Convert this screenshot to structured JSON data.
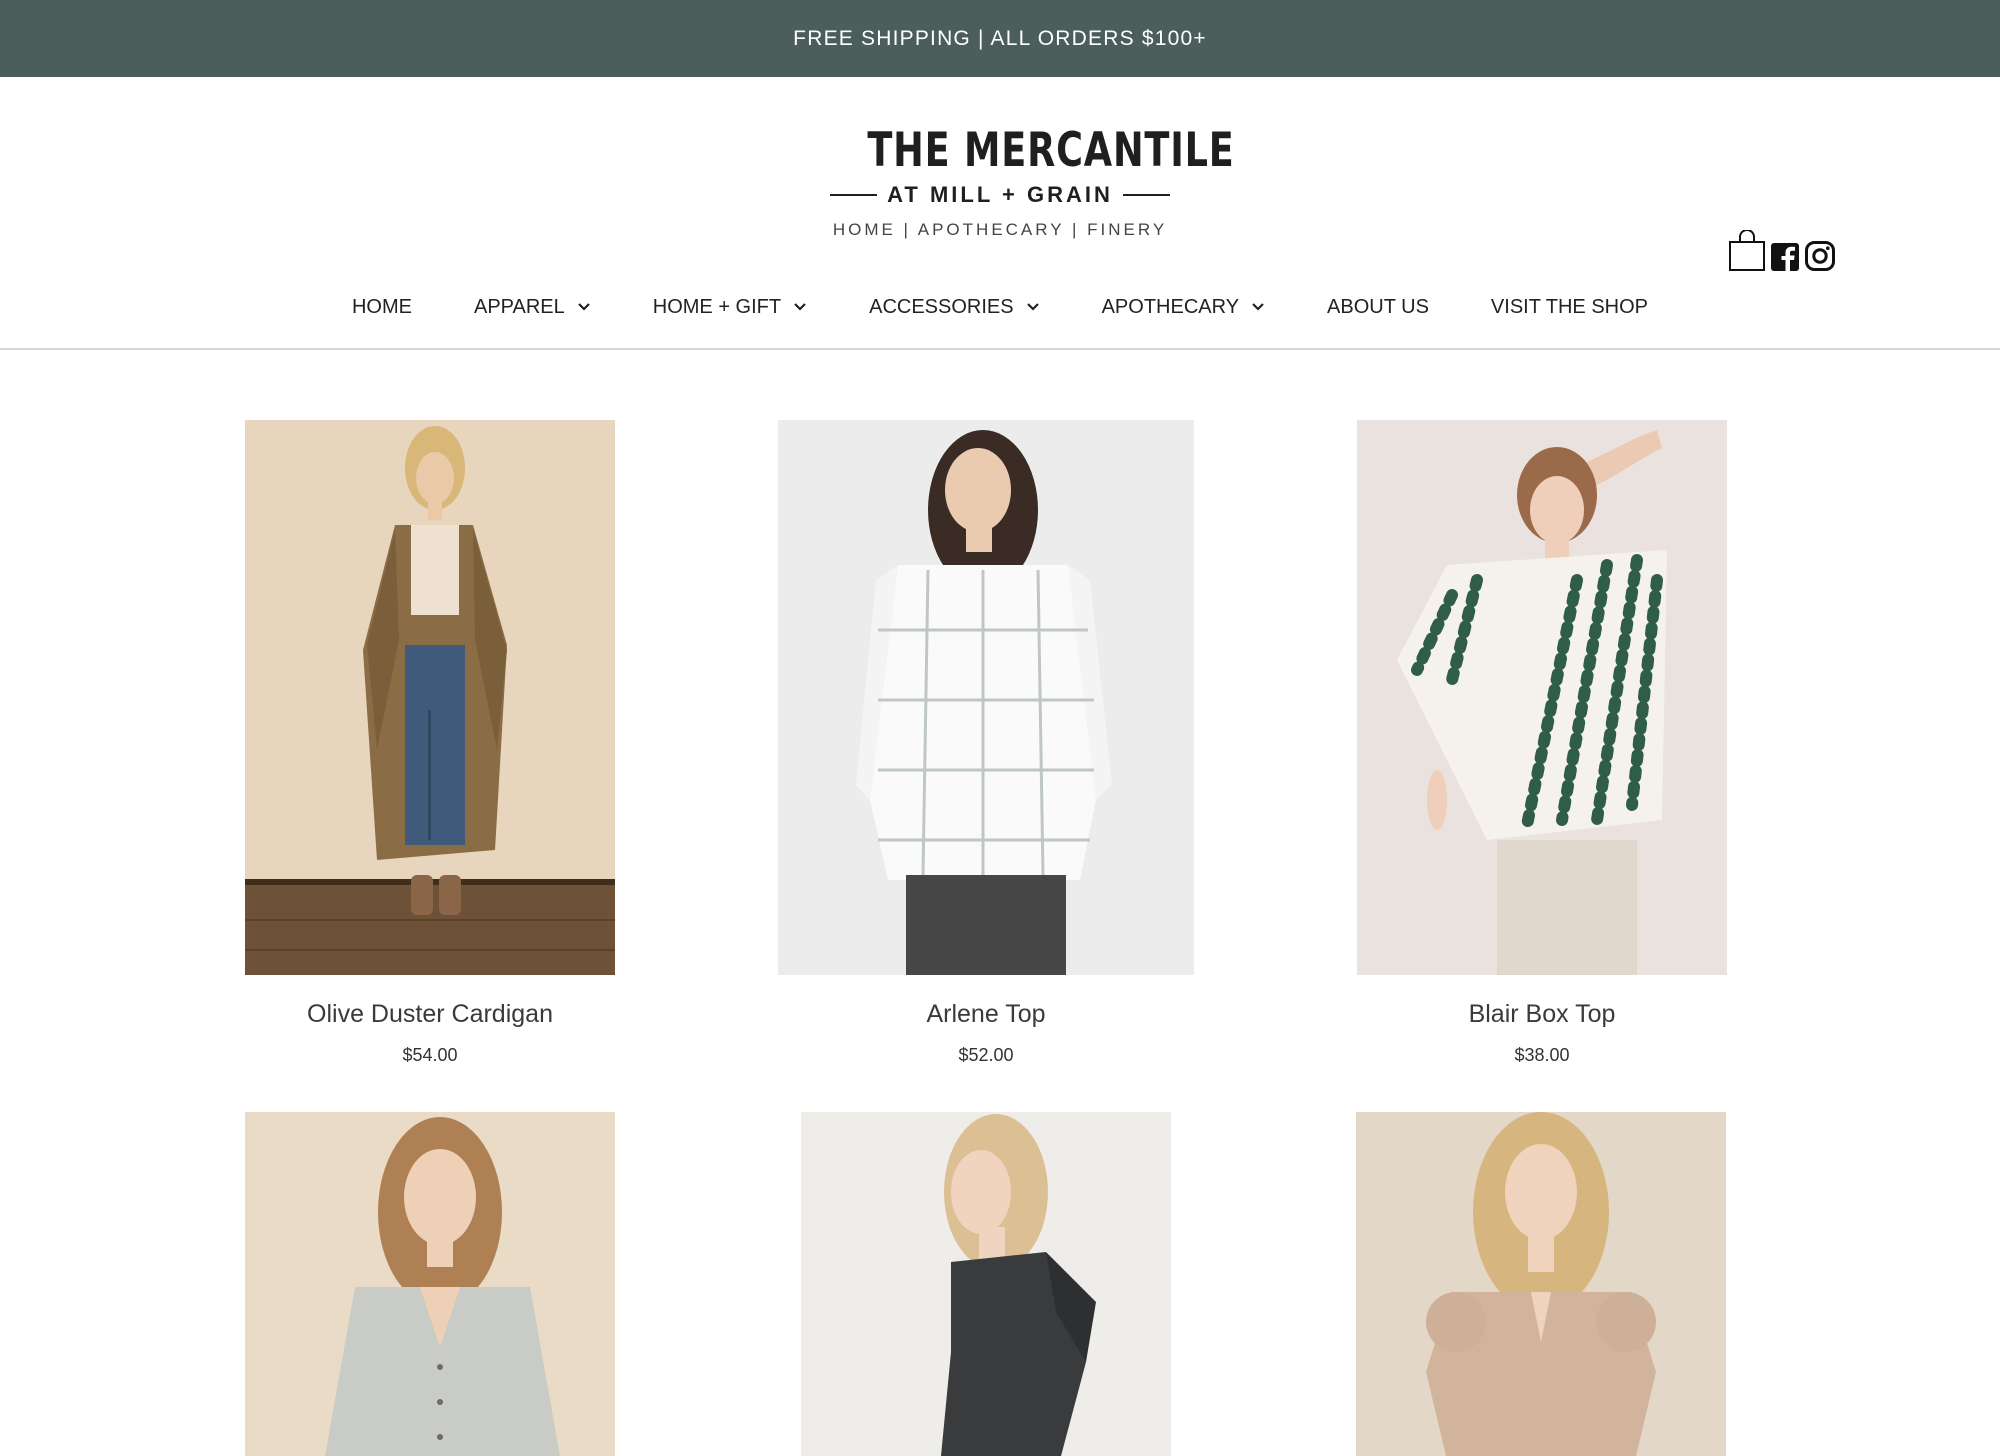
{
  "announcement": {
    "text": "FREE SHIPPING | ALL ORDERS $100+"
  },
  "logo": {
    "main": "THE MERCANTILE",
    "sub": "AT MILL + GRAIN",
    "tagline": "HOME | APOTHECARY | FINERY"
  },
  "header_icons": [
    "shopping-bag-icon",
    "facebook-icon",
    "instagram-icon"
  ],
  "nav": {
    "items": [
      {
        "label": "HOME",
        "has_dropdown": false
      },
      {
        "label": "APPAREL",
        "has_dropdown": true
      },
      {
        "label": "HOME + GIFT",
        "has_dropdown": true
      },
      {
        "label": "ACCESSORIES",
        "has_dropdown": true
      },
      {
        "label": "APOTHECARY",
        "has_dropdown": true
      },
      {
        "label": "ABOUT US",
        "has_dropdown": false
      },
      {
        "label": "VISIT THE SHOP",
        "has_dropdown": false
      }
    ]
  },
  "products": [
    {
      "name": "Olive Duster Cardigan",
      "price": "$54.00"
    },
    {
      "name": "Arlene Top",
      "price": "$52.00"
    },
    {
      "name": "Blair Box Top",
      "price": "$38.00"
    },
    {
      "name": "",
      "price": ""
    },
    {
      "name": "",
      "price": ""
    },
    {
      "name": "",
      "price": ""
    }
  ],
  "colors": {
    "announcement_bg": "#4b5e5c",
    "text": "#222222",
    "divider": "#d6d6d6"
  }
}
